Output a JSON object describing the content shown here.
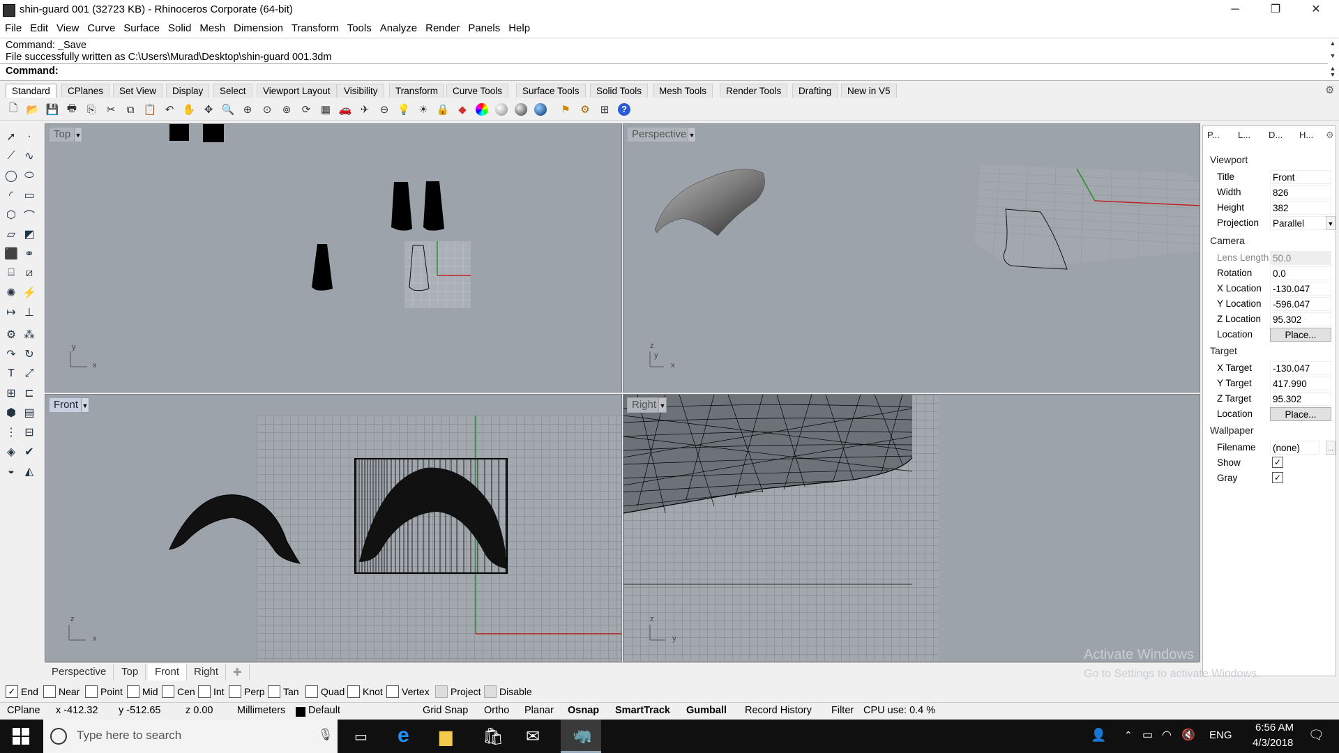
{
  "window": {
    "title": "shin-guard 001 (32723 KB) - Rhinoceros Corporate (64-bit)",
    "minimize": "─",
    "restore": "❐",
    "close": "✕"
  },
  "menu": [
    "File",
    "Edit",
    "View",
    "Curve",
    "Surface",
    "Solid",
    "Mesh",
    "Dimension",
    "Transform",
    "Tools",
    "Analyze",
    "Render",
    "Panels",
    "Help"
  ],
  "command": {
    "line1": "Command: _Save",
    "line2": "File successfully written as C:\\Users\\Murad\\Desktop\\shin-guard 001.3dm",
    "prompt": "Command:"
  },
  "tabs": [
    "Standard",
    "CPlanes",
    "Set View",
    "Display",
    "Select",
    "Viewport Layout",
    "Visibility",
    "Transform",
    "Curve Tools",
    "Surface Tools",
    "Solid Tools",
    "Mesh Tools",
    "Render Tools",
    "Drafting",
    "New in V5"
  ],
  "toolbar_icons": [
    "new-icon",
    "open-icon",
    "save-icon",
    "print-icon",
    "import-icon",
    "cut-icon",
    "copy-icon",
    "paste-icon",
    "undo-icon",
    "pan-icon",
    "move-view-icon",
    "zoom-icon",
    "zoom-window-icon",
    "zoom-extents-icon",
    "zoom-selected-icon",
    "rotate-view-icon",
    "four-view-icon",
    "car-icon",
    "plane-icon",
    "cplane-icon",
    "show-icon",
    "light-icon",
    "lock-icon",
    "layer-icon",
    "color-wheel-icon",
    "wireframe-sphere-icon",
    "shaded-sphere-icon",
    "rendered-sphere-icon",
    "render-icon",
    "options-icon",
    "grid-options-icon",
    "help-icon"
  ],
  "viewports": {
    "top": {
      "label": "Top"
    },
    "perspective": {
      "label": "Perspective"
    },
    "front": {
      "label": "Front"
    },
    "right": {
      "label": "Right"
    }
  },
  "axes": {
    "x": "x",
    "y": "y",
    "z": "z"
  },
  "viewport_tabs": [
    "Perspective",
    "Top",
    "Front",
    "Right"
  ],
  "osnap": [
    {
      "label": "End",
      "checked": true
    },
    {
      "label": "Near",
      "checked": false
    },
    {
      "label": "Point",
      "checked": false
    },
    {
      "label": "Mid",
      "checked": false
    },
    {
      "label": "Cen",
      "checked": false
    },
    {
      "label": "Int",
      "checked": false
    },
    {
      "label": "Perp",
      "checked": false
    },
    {
      "label": "Tan",
      "checked": false
    },
    {
      "label": "Quad",
      "checked": false
    },
    {
      "label": "Knot",
      "checked": false
    },
    {
      "label": "Vertex",
      "checked": false
    },
    {
      "label": "Project",
      "checked": false,
      "disabled": true
    },
    {
      "label": "Disable",
      "checked": false,
      "disabled": true
    }
  ],
  "status": {
    "cplane": "CPlane",
    "x": "x -412.32",
    "y": "y -512.65",
    "z": "z 0.00",
    "units": "Millimeters",
    "layer": "Default",
    "grid_snap": "Grid Snap",
    "ortho": "Ortho",
    "planar": "Planar",
    "osnap": "Osnap",
    "smarttrack": "SmartTrack",
    "gumball": "Gumball",
    "record_history": "Record History",
    "filter": "Filter",
    "cpu": "CPU use: 0.4 %"
  },
  "panel": {
    "tabs": [
      "P...",
      "L...",
      "D...",
      "H..."
    ],
    "viewport_section": "Viewport",
    "title_k": "Title",
    "title_v": "Front",
    "width_k": "Width",
    "width_v": "826",
    "height_k": "Height",
    "height_v": "382",
    "projection_k": "Projection",
    "projection_v": "Parallel",
    "camera_section": "Camera",
    "lens_k": "Lens Length",
    "lens_v": "50.0",
    "rotation_k": "Rotation",
    "rotation_v": "0.0",
    "xloc_k": "X Location",
    "xloc_v": "-130.047",
    "yloc_k": "Y Location",
    "yloc_v": "-596.047",
    "zloc_k": "Z Location",
    "zloc_v": "95.302",
    "loc_k": "Location",
    "place": "Place...",
    "target_section": "Target",
    "xt_k": "X Target",
    "xt_v": "-130.047",
    "yt_k": "Y Target",
    "yt_v": "417.990",
    "zt_k": "Z Target",
    "zt_v": "95.302",
    "tloc_k": "Location",
    "wallpaper_section": "Wallpaper",
    "filename_k": "Filename",
    "filename_v": "(none)",
    "browse": "...",
    "show_k": "Show",
    "gray_k": "Gray"
  },
  "watermark": {
    "line1": "Activate Windows",
    "line2": "Go to Settings to activate Windows."
  },
  "taskbar": {
    "search_placeholder": "Type here to search",
    "time": "6:56 AM",
    "date": "4/3/2018",
    "lang": "ENG"
  }
}
